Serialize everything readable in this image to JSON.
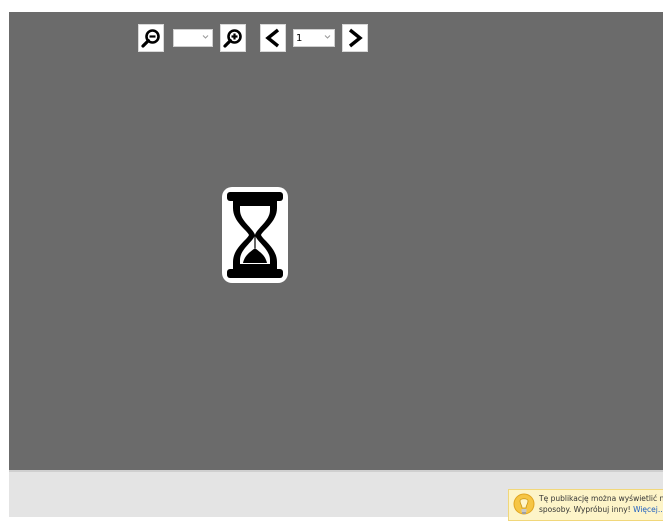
{
  "toolbar": {
    "zoom_value": "",
    "page_value": "1"
  },
  "notice": {
    "line1": "Tę publikację można wyświetlić na różne",
    "line2": "sposoby. Wypróbuj inny!",
    "link": "Więcej..."
  },
  "icons": {
    "zoom_out": "magnifier-minus-icon",
    "zoom_in": "magnifier-plus-icon",
    "prev": "chevron-left-icon",
    "next": "chevron-right-icon",
    "loading": "hourglass-icon",
    "notice": "lightbulb-icon"
  },
  "colors": {
    "viewer_bg": "#6b6b6b",
    "notice_bg": "#fdf4c8",
    "link": "#1f5fbf"
  }
}
